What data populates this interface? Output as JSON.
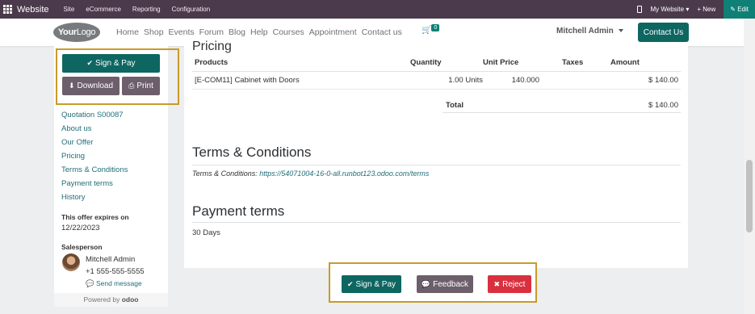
{
  "adminbar": {
    "brand": "Website",
    "menus": [
      "Site",
      "eCommerce",
      "Reporting",
      "Configuration"
    ],
    "my_website": "My Website",
    "new": "New",
    "edit": "Edit"
  },
  "header": {
    "logo_your": "Your",
    "logo_logo": "Logo",
    "nav": [
      "Home",
      "Shop",
      "Events",
      "Forum",
      "Blog",
      "Help",
      "Courses",
      "Appointment",
      "Contact us"
    ],
    "cart_icon": "cart-icon",
    "cart_count": "0",
    "user": "Mitchell Admin",
    "contact_button": "Contact Us"
  },
  "sidebar": {
    "sign_pay": "Sign & Pay",
    "download": "Download",
    "print": "Print",
    "toc": [
      "Quotation S00087",
      "About us",
      "Our Offer",
      "Pricing",
      "Terms & Conditions",
      "Payment terms",
      "History"
    ],
    "expire_label": "This offer expires on",
    "expire_date": "12/22/2023",
    "salesperson_label": "Salesperson",
    "salesperson_name": "Mitchell Admin",
    "salesperson_phone": "+1 555-555-5555",
    "send_message": "Send message",
    "powered_by": "Powered by",
    "powered_brand": "odoo"
  },
  "main": {
    "pricing_title": "Pricing",
    "table": {
      "headers": [
        "Products",
        "Quantity",
        "Unit Price",
        "Taxes",
        "Amount"
      ],
      "rows": [
        {
          "product": "[E-COM11] Cabinet with Doors",
          "quantity": "1.00 Units",
          "unit_price": "140.000",
          "taxes": "",
          "amount": "$ 140.00"
        }
      ],
      "total_label": "Total",
      "total_value": "$ 140.00"
    },
    "terms_title": "Terms & Conditions",
    "terms_prefix": "Terms & Conditions:",
    "terms_link": "https://54071004-16-0-all.runbot123.odoo.com/terms",
    "payment_title": "Payment terms",
    "payment_text": "30 Days"
  },
  "bottom": {
    "sign_pay": "Sign & Pay",
    "feedback": "Feedback",
    "reject": "Reject"
  },
  "colors": {
    "admin_bar": "#4b3a4c",
    "primary": "#0e6661",
    "secondary": "#6c5f6b",
    "danger": "#d9303f",
    "highlight_border": "#c99a2a",
    "link": "#1f6f79"
  }
}
